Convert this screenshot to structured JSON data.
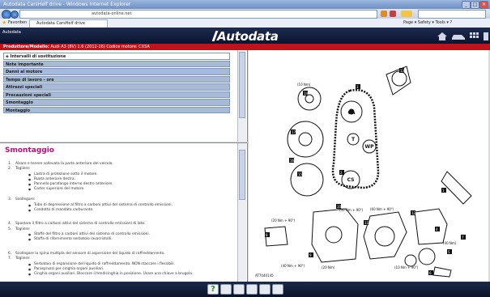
{
  "window": {
    "title": "Autodata CarsHelf drive - Windows Internet Explorer",
    "address": "autodata-online.net",
    "tab_label": "Autodata CarsHelf drive",
    "favorites_label": "Favoriten",
    "toolbar_right": "Page ▾  Safety ▾  Tools ▾  ?"
  },
  "app": {
    "name": "Autodata",
    "logo": "/Autodata",
    "vehicle_label": "Produttore/Modello:",
    "vehicle_value": "Audi A3 (8V) 1.6 (2012-16)   Codice motore: CXSA",
    "brand_color": "#c1121c"
  },
  "menu": {
    "items": [
      {
        "label": "◈ Intervalli di sostituzione",
        "active": true
      },
      {
        "label": "Note importante"
      },
      {
        "label": "Danni al motore"
      },
      {
        "label": "Tempo di lavoro - ore"
      },
      {
        "label": "Attrezzi speciali"
      },
      {
        "label": "Precauzioni speciali"
      },
      {
        "label": "Smontaggio"
      },
      {
        "label": "Montaggio"
      }
    ]
  },
  "content": {
    "title": "Smontaggio",
    "steps": [
      {
        "n": "1.",
        "text": "Alzare e tenere sollevata la parte anteriore del veicolo."
      },
      {
        "n": "2.",
        "text": "Togliere:"
      },
      {
        "n": "3.",
        "text": "Scollegare:"
      },
      {
        "n": "4.",
        "text": "Spostare il filtro a carboni attivi del sistema di controllo emissioni di lato."
      },
      {
        "n": "5.",
        "text": "Togliere:"
      },
      {
        "n": "6.",
        "text": "Scollegare la spina multipla del sensore di aspersione del liquido di raffreddamento."
      },
      {
        "n": "7.",
        "text": "Togliere:"
      }
    ],
    "bullets": [
      "Lastra di protezione sotto il motore.",
      "Ruota anteriore destra.",
      "Pannello parafango interno destro anteriore.",
      "Carter superiore del motore.",
      "Tubo di depressione al filtro a carboni attivi del sistema di controllo emissioni.",
      "Condotto di mandata carburante.",
      "Staffe del filtro a carboni attivi del sistema di controllo emissioni.",
      "Staffa di rifornimento serbatoio lavacristalli.",
      "Serbatoio di espansione del liquido di raffreddamento. NON staccare i flessibili.",
      "Paraspruzzi per cinghia organi ausiliari.",
      "Cinghia organi ausiliari. Bloccare il tendicinghia in posizione. Usare una chiave a brugola."
    ]
  },
  "diagram": {
    "labels": {
      "ca": "CA",
      "t": "T",
      "wp": "WP",
      "cs": "CS",
      "dim1": "(10 Nm)",
      "dim2": "(20 Nm + 90°)",
      "dim3": "(50 Nm + 90°)",
      "dim4": "(40 Nm)",
      "dim5": "(60 Nm + 90°)",
      "dim6": "(40 Nm + 90°)",
      "dim7": "(10 Nm + 90°)",
      "dim8": "(20 Nm)",
      "code": "AT7040145"
    },
    "numbers": [
      "1",
      "2",
      "3",
      "4",
      "5",
      "6",
      "7",
      "8",
      "9",
      "10",
      "11",
      "12",
      "13",
      "14",
      "15",
      "16",
      "17"
    ]
  }
}
